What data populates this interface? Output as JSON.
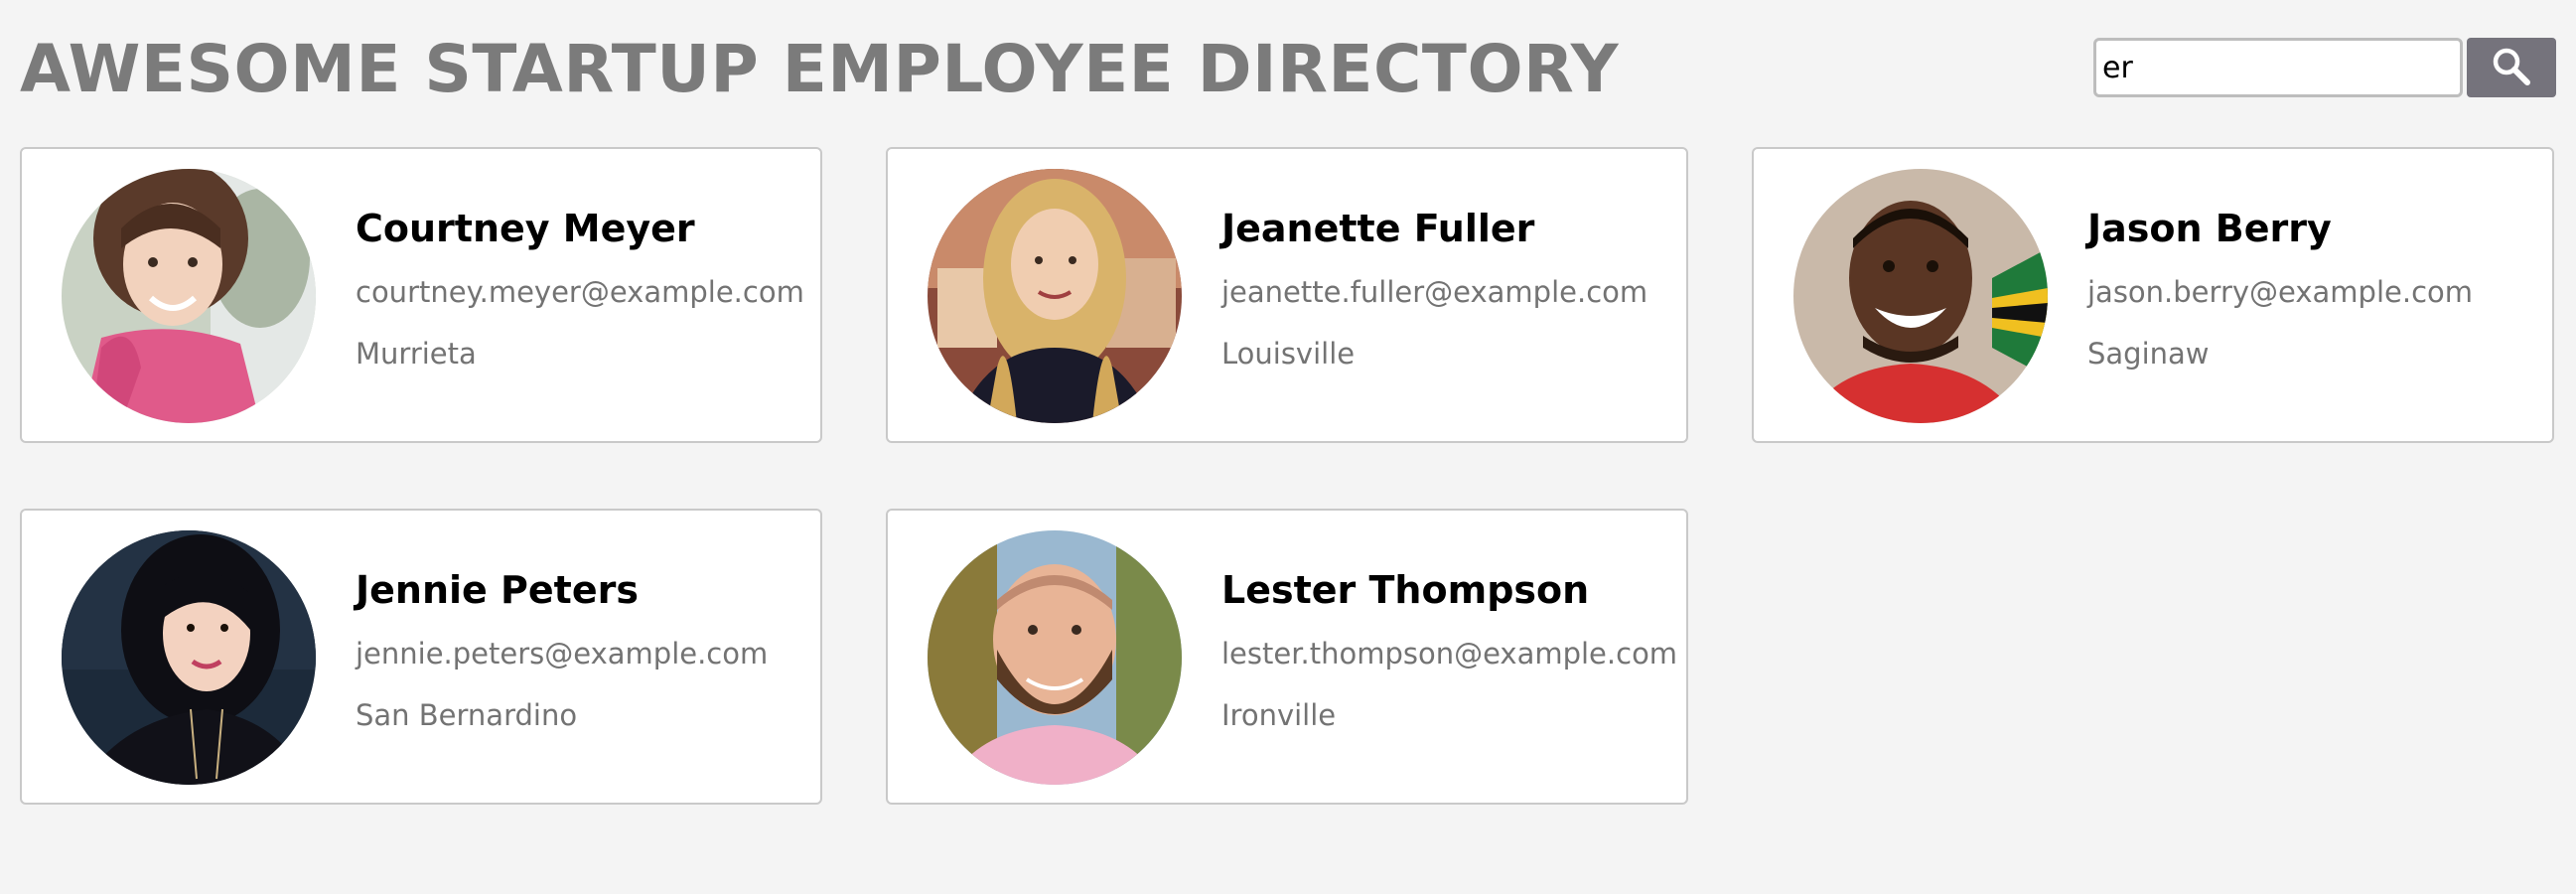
{
  "header": {
    "title": "AWESOME STARTUP EMPLOYEE DIRECTORY"
  },
  "search": {
    "value": "er",
    "icon": "search-icon",
    "button_color": "#75737c"
  },
  "employees": [
    {
      "name": "Courtney Meyer",
      "email": "courtney.meyer@example.com",
      "city": "Murrieta"
    },
    {
      "name": "Jeanette Fuller",
      "email": "jeanette.fuller@example.com",
      "city": "Louisville"
    },
    {
      "name": "Jason Berry",
      "email": "jason.berry@example.com",
      "city": "Saginaw"
    },
    {
      "name": "Jennie Peters",
      "email": "jennie.peters@example.com",
      "city": "San Bernardino"
    },
    {
      "name": "Lester Thompson",
      "email": "lester.thompson@example.com",
      "city": "Ironville"
    }
  ]
}
